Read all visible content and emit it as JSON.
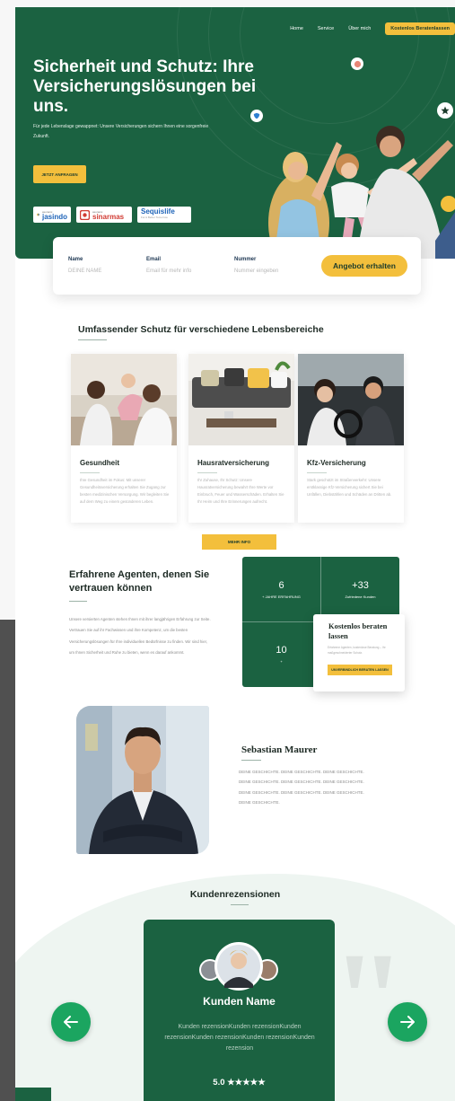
{
  "nav": {
    "items": [
      "Home",
      "Service",
      "Über mich"
    ],
    "cta": "Kostenlos Beratenlassen"
  },
  "hero": {
    "title": "Sicherheit und Schutz: Ihre Versicherungslösungen bei uns.",
    "subtitle": "Für jede Lebenslage gewappnet: Unsere Versicherungen sichern Ihnen eine sorgenfreie Zukunft.",
    "button": "JETZT ANFRAGEN",
    "partners": {
      "p1": "jasindo",
      "p1_small": "asuransi",
      "p2": "sinarmas",
      "p2_small": "asuransi",
      "p3": "Sequislife",
      "p3_small": "For A Better Tomorrow"
    }
  },
  "form": {
    "name_label": "Name",
    "name_placeholder": "DEINE NAME",
    "email_label": "Email",
    "email_placeholder": "Email für mehr info",
    "number_label": "Nummer",
    "number_placeholder": "Nummer eingeben",
    "submit": "Angebot erhalten"
  },
  "services": {
    "title": "Umfassender Schutz für verschiedene Lebensbereiche",
    "cards": [
      {
        "title": "Gesundheit",
        "text": "Ihre Gesundheit im Fokus: Mit unserer Gesundheitsversicherung erhalten Sie Zugang zur besten medizinischen Versorgung. Wir begleiten Sie auf dem Weg zu einem gesünderen Leben."
      },
      {
        "title": "Hausratversicherung",
        "text": "Ihr Zuhause, Ihr Schutz: Unsere Hausratversicherung bewahrt Ihre Werte vor Einbruch, Feuer und Wasserschäden. Erhalten Sie Ihr Heim und Ihre Erinnerungen aufrecht."
      },
      {
        "title": "Kfz-Versicherung",
        "text": "Stark geschützt im Straßenverkehr: Unsere erstklassige Kfz-Versicherung sichert Sie bei Unfällen, Diebstählen und Schäden an Dritten ab."
      }
    ],
    "more": "MEHR INFO"
  },
  "agents": {
    "title": "Erfahrene Agenten, denen Sie vertrauen können",
    "text": "Unsere versierten Agenten stehen Ihnen mit ihrer langjährigen Erfahrung zur Seite. Vertrauen Sie auf ihr Fachwissen und ihre Kompetenz, um die besten Versicherungslösungen für Ihre individuellen Bedürfnisse zu finden. Wir sind hier, um Ihnen Sicherheit und Ruhe zu bieten, wenn es darauf ankommt.",
    "stats": [
      {
        "number": "6",
        "label": "+ JAHRE ERFAHRUNG"
      },
      {
        "number": "+33",
        "label": "Zufriedene Kunden"
      },
      {
        "number": "10",
        "label": "+"
      }
    ],
    "consult": {
      "title": "Kostenlos beraten lassen",
      "text": "Erfahrene Agenten, kostenlose Beratung – Ihr maßgeschneiderter Schutz.",
      "button": "UNVERBINDLICH BERATEN LASSEN"
    }
  },
  "person": {
    "name": "Sebastian Maurer",
    "text": "DEINE GESCHICHTE. DEINE GESCHICHTE. DEINE GESCHICHTE. DEINE GESCHICHTE. DEINE GESCHICHTE. DEINE GESCHICHTE. DEINE GESCHICHTE. DEINE GESCHICHTE. DEINE GESCHICHTE. DEINE GESCHICHTE."
  },
  "reviews": {
    "title": "Kundenrezensionen",
    "name": "Kunden Name",
    "text": "Kunden rezensionKunden rezensionKunden rezensionKunden rezensionKunden rezensionKunden rezension",
    "rating": "5.0 ★★★★★"
  },
  "colors": {
    "primary": "#1b6241",
    "accent": "#f3bf3c",
    "arrow": "#1ba560"
  }
}
